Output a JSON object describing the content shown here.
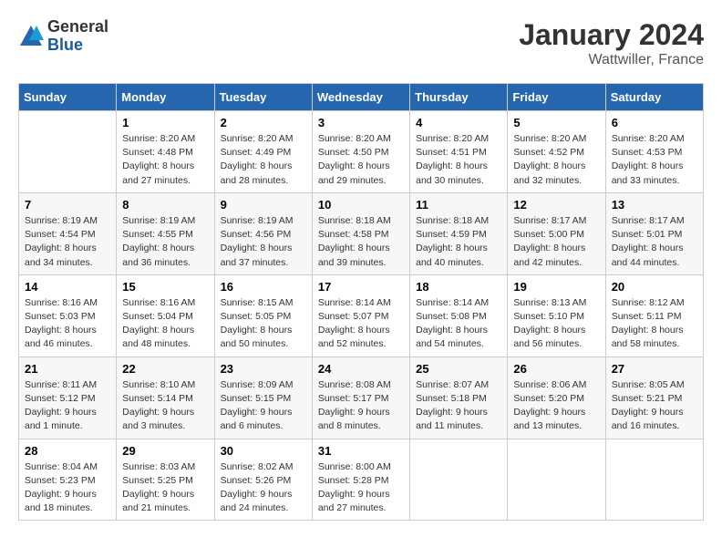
{
  "header": {
    "logo_general": "General",
    "logo_blue": "Blue",
    "month_year": "January 2024",
    "location": "Wattwiller, France"
  },
  "weekdays": [
    "Sunday",
    "Monday",
    "Tuesday",
    "Wednesday",
    "Thursday",
    "Friday",
    "Saturday"
  ],
  "weeks": [
    [
      {
        "day": "",
        "info": ""
      },
      {
        "day": "1",
        "info": "Sunrise: 8:20 AM\nSunset: 4:48 PM\nDaylight: 8 hours\nand 27 minutes."
      },
      {
        "day": "2",
        "info": "Sunrise: 8:20 AM\nSunset: 4:49 PM\nDaylight: 8 hours\nand 28 minutes."
      },
      {
        "day": "3",
        "info": "Sunrise: 8:20 AM\nSunset: 4:50 PM\nDaylight: 8 hours\nand 29 minutes."
      },
      {
        "day": "4",
        "info": "Sunrise: 8:20 AM\nSunset: 4:51 PM\nDaylight: 8 hours\nand 30 minutes."
      },
      {
        "day": "5",
        "info": "Sunrise: 8:20 AM\nSunset: 4:52 PM\nDaylight: 8 hours\nand 32 minutes."
      },
      {
        "day": "6",
        "info": "Sunrise: 8:20 AM\nSunset: 4:53 PM\nDaylight: 8 hours\nand 33 minutes."
      }
    ],
    [
      {
        "day": "7",
        "info": "Sunrise: 8:19 AM\nSunset: 4:54 PM\nDaylight: 8 hours\nand 34 minutes."
      },
      {
        "day": "8",
        "info": "Sunrise: 8:19 AM\nSunset: 4:55 PM\nDaylight: 8 hours\nand 36 minutes."
      },
      {
        "day": "9",
        "info": "Sunrise: 8:19 AM\nSunset: 4:56 PM\nDaylight: 8 hours\nand 37 minutes."
      },
      {
        "day": "10",
        "info": "Sunrise: 8:18 AM\nSunset: 4:58 PM\nDaylight: 8 hours\nand 39 minutes."
      },
      {
        "day": "11",
        "info": "Sunrise: 8:18 AM\nSunset: 4:59 PM\nDaylight: 8 hours\nand 40 minutes."
      },
      {
        "day": "12",
        "info": "Sunrise: 8:17 AM\nSunset: 5:00 PM\nDaylight: 8 hours\nand 42 minutes."
      },
      {
        "day": "13",
        "info": "Sunrise: 8:17 AM\nSunset: 5:01 PM\nDaylight: 8 hours\nand 44 minutes."
      }
    ],
    [
      {
        "day": "14",
        "info": "Sunrise: 8:16 AM\nSunset: 5:03 PM\nDaylight: 8 hours\nand 46 minutes."
      },
      {
        "day": "15",
        "info": "Sunrise: 8:16 AM\nSunset: 5:04 PM\nDaylight: 8 hours\nand 48 minutes."
      },
      {
        "day": "16",
        "info": "Sunrise: 8:15 AM\nSunset: 5:05 PM\nDaylight: 8 hours\nand 50 minutes."
      },
      {
        "day": "17",
        "info": "Sunrise: 8:14 AM\nSunset: 5:07 PM\nDaylight: 8 hours\nand 52 minutes."
      },
      {
        "day": "18",
        "info": "Sunrise: 8:14 AM\nSunset: 5:08 PM\nDaylight: 8 hours\nand 54 minutes."
      },
      {
        "day": "19",
        "info": "Sunrise: 8:13 AM\nSunset: 5:10 PM\nDaylight: 8 hours\nand 56 minutes."
      },
      {
        "day": "20",
        "info": "Sunrise: 8:12 AM\nSunset: 5:11 PM\nDaylight: 8 hours\nand 58 minutes."
      }
    ],
    [
      {
        "day": "21",
        "info": "Sunrise: 8:11 AM\nSunset: 5:12 PM\nDaylight: 9 hours\nand 1 minute."
      },
      {
        "day": "22",
        "info": "Sunrise: 8:10 AM\nSunset: 5:14 PM\nDaylight: 9 hours\nand 3 minutes."
      },
      {
        "day": "23",
        "info": "Sunrise: 8:09 AM\nSunset: 5:15 PM\nDaylight: 9 hours\nand 6 minutes."
      },
      {
        "day": "24",
        "info": "Sunrise: 8:08 AM\nSunset: 5:17 PM\nDaylight: 9 hours\nand 8 minutes."
      },
      {
        "day": "25",
        "info": "Sunrise: 8:07 AM\nSunset: 5:18 PM\nDaylight: 9 hours\nand 11 minutes."
      },
      {
        "day": "26",
        "info": "Sunrise: 8:06 AM\nSunset: 5:20 PM\nDaylight: 9 hours\nand 13 minutes."
      },
      {
        "day": "27",
        "info": "Sunrise: 8:05 AM\nSunset: 5:21 PM\nDaylight: 9 hours\nand 16 minutes."
      }
    ],
    [
      {
        "day": "28",
        "info": "Sunrise: 8:04 AM\nSunset: 5:23 PM\nDaylight: 9 hours\nand 18 minutes."
      },
      {
        "day": "29",
        "info": "Sunrise: 8:03 AM\nSunset: 5:25 PM\nDaylight: 9 hours\nand 21 minutes."
      },
      {
        "day": "30",
        "info": "Sunrise: 8:02 AM\nSunset: 5:26 PM\nDaylight: 9 hours\nand 24 minutes."
      },
      {
        "day": "31",
        "info": "Sunrise: 8:00 AM\nSunset: 5:28 PM\nDaylight: 9 hours\nand 27 minutes."
      },
      {
        "day": "",
        "info": ""
      },
      {
        "day": "",
        "info": ""
      },
      {
        "day": "",
        "info": ""
      }
    ]
  ]
}
